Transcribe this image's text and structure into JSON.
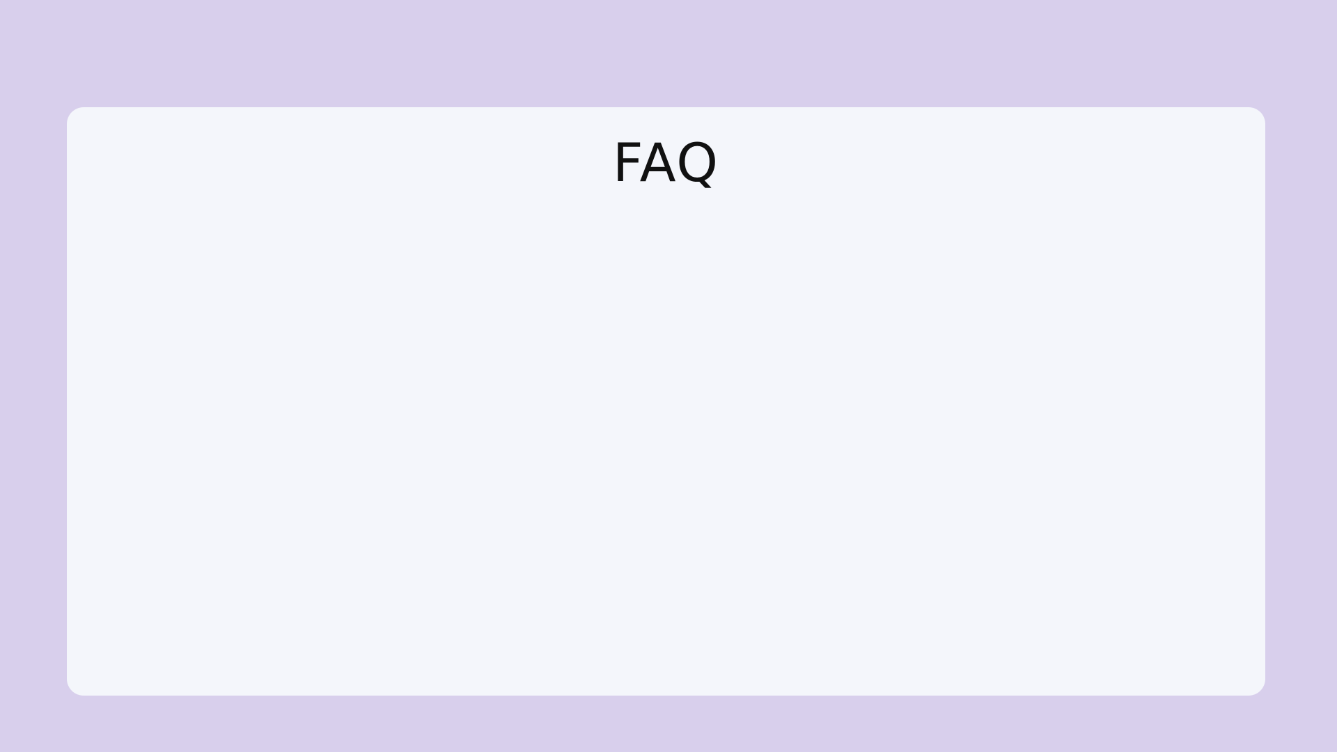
{
  "page": {
    "title": "FAQ"
  },
  "colors": {
    "background": "#d8cfec",
    "card": "#f4f6fb",
    "text": "#111111"
  }
}
